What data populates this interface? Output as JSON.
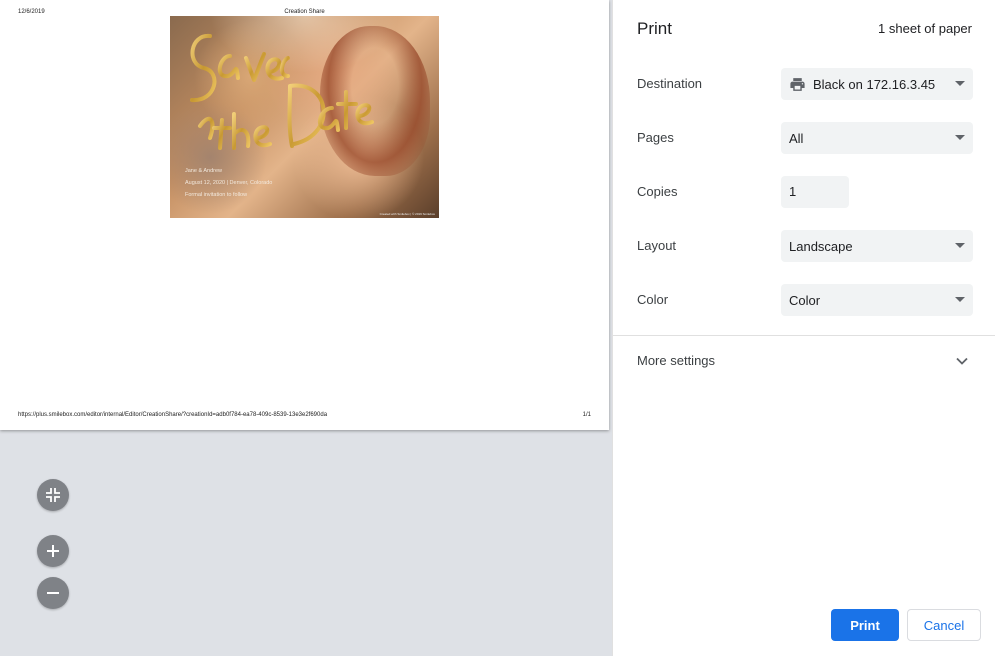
{
  "preview": {
    "date": "12/6/2019",
    "doc_title": "Creation Share",
    "url": "https://plus.smilebox.com/editor/internal/Editor/CreationShare/?creationId=adb0f784-ea78-409c-8539-13e3e2f690da",
    "page_number": "1/1",
    "photo": {
      "names": "Jane & Andrew",
      "date_line": "August 12, 2020 | Denver, Colorado",
      "line3": "Formal invitation to follow",
      "credit": "Created with Smilebox | © 2019 Smilebox"
    }
  },
  "zoom": {
    "fit_icon": "fit-to-page-icon",
    "zoom_in_icon": "plus-icon",
    "zoom_out_icon": "minus-icon"
  },
  "settings": {
    "title": "Print",
    "sheet_count": "1 sheet of paper",
    "destination": {
      "label": "Destination",
      "value": "Black on 172.16.3.45",
      "icon": "printer-icon"
    },
    "pages": {
      "label": "Pages",
      "value": "All"
    },
    "copies": {
      "label": "Copies",
      "value": "1"
    },
    "layout": {
      "label": "Layout",
      "value": "Landscape"
    },
    "color": {
      "label": "Color",
      "value": "Color"
    },
    "more_settings": "More settings",
    "print_button": "Print",
    "cancel_button": "Cancel"
  },
  "colors": {
    "accent": "#1a73e8",
    "preview_bg": "#dee1e6",
    "field_bg": "#f1f3f4"
  }
}
